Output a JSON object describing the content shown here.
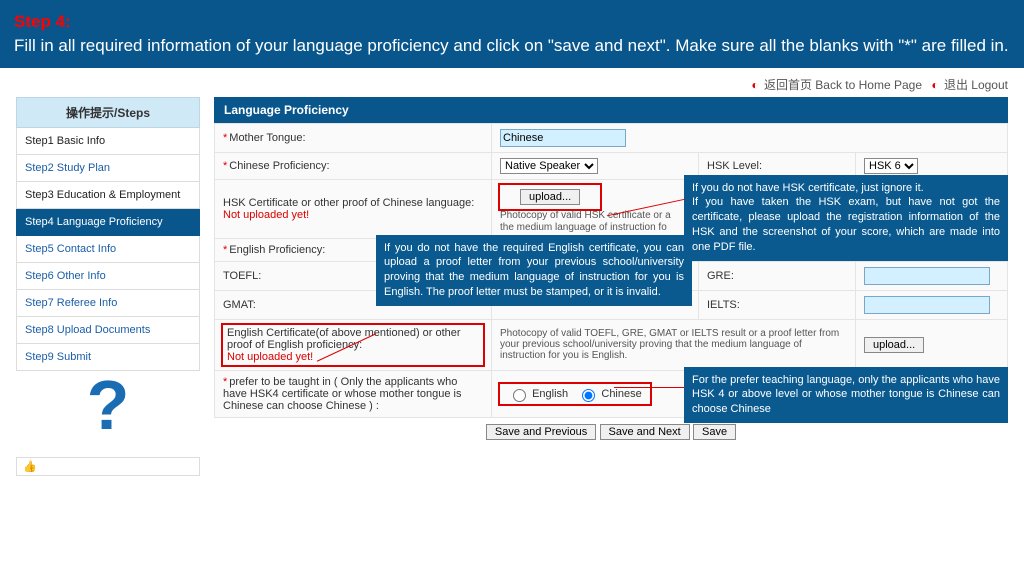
{
  "banner": {
    "step_label": "Step 4:",
    "text": "Fill in all required information of your  language proficiency and click on \"save and next\". Make sure all the blanks with \"*\" are filled in."
  },
  "top_links": {
    "back": "返回首页 Back to Home Page",
    "logout": "退出 Logout"
  },
  "sidebar": {
    "header": "操作提示/Steps",
    "items": [
      "Step1 Basic Info",
      "Step2 Study Plan",
      "Step3 Education & Employment",
      "Step4 Language Proficiency",
      "Step5 Contact Info",
      "Step6 Other Info",
      "Step7 Referee Info",
      "Step8 Upload Documents",
      "Step9 Submit"
    ],
    "active_index": 3
  },
  "section_title": "Language Proficiency",
  "labels": {
    "mother_tongue": "Mother Tongue:",
    "chinese_prof": "Chinese Proficiency:",
    "hsk_level": "HSK Level:",
    "hsk_cert": "HSK Certificate or other proof of Chinese language:",
    "not_uploaded": "Not uploaded yet!",
    "hsk_photo_hint": "Photocopy of valid HSK certificate or a proof letter from your previous school/university proving that the medium language of instruction for you is Chinese.",
    "english_prof": "English Proficiency:",
    "toefl": "TOEFL:",
    "gmat": "GMAT:",
    "gre": "GRE:",
    "ielts": "IELTS:",
    "eng_cert": "English Certificate(of above mentioned) or other proof of English proficiency:",
    "eng_photo_hint": "Photocopy of valid TOEFL, GRE, GMAT or IELTS result or a proof letter from your previous school/university proving that the medium language of instruction for you is English.",
    "prefer": "prefer to be taught in ( Only the applicants who have HSK4 certificate or whose mother tongue is Chinese can choose Chinese ) :",
    "english_opt": "English",
    "chinese_opt": "Chinese"
  },
  "values": {
    "mother_tongue": "Chinese",
    "chinese_prof": "Native Speaker",
    "hsk_level": "HSK 6",
    "prefer_selected": "Chinese"
  },
  "buttons": {
    "upload": "upload...",
    "save_prev": "Save and Previous",
    "save_next": "Save and Next",
    "save": "Save"
  },
  "annotations": {
    "eng": "If you do not have the required English certificate, you can upload a proof letter from your previous school/university proving that the medium language of instruction for you is English. The proof letter must be stamped, or it is invalid.",
    "hsk": "If you do not have HSK certificate, just ignore it.\nIf you have taken the HSK exam, but have not got the certificate, please upload the registration information of the HSK and the screenshot of your score, which are made into one PDF file.",
    "prefer": "For the prefer teaching language, only the applicants who have HSK 4 or above level or whose mother tongue is Chinese can choose Chinese"
  }
}
